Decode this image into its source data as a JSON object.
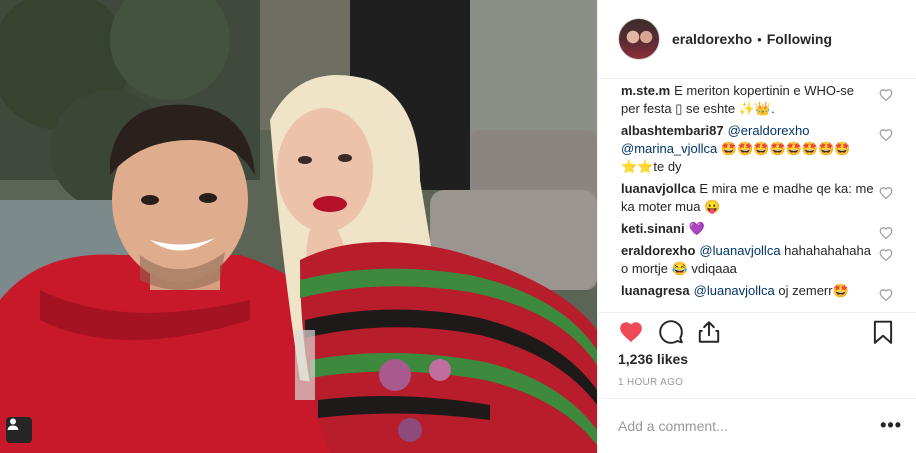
{
  "post": {
    "photo_alt": "",
    "header": {
      "username": "eraldorexho",
      "separator": "•",
      "follow_status": "Following"
    },
    "comments": [
      {
        "user": "m.ste.m",
        "segments": [
          {
            "type": "text",
            "value": "E meriton kopertinin e WHO-se per festa ▯ se eshte ✨👑."
          }
        ]
      },
      {
        "user": "albashtembari87",
        "segments": [
          {
            "type": "mention",
            "value": "@eraldorexho"
          },
          {
            "type": "text",
            "value": " "
          },
          {
            "type": "mention",
            "value": "@marina_vjollca"
          },
          {
            "type": "text",
            "value": " 🤩🤩🤩🤩🤩🤩🤩🤩⭐⭐te dy"
          }
        ]
      },
      {
        "user": "luanavjollca",
        "segments": [
          {
            "type": "text",
            "value": "E mira me e madhe qe ka: me ka moter mua 😛"
          }
        ]
      },
      {
        "user": "keti.sinani",
        "segments": [
          {
            "type": "text",
            "value": "💜"
          }
        ]
      },
      {
        "user": "eraldorexho",
        "segments": [
          {
            "type": "mention",
            "value": "@luanavjollca"
          },
          {
            "type": "text",
            "value": " hahahahahaha o mortje 😂 vdiqaaa"
          }
        ]
      },
      {
        "user": "luanagresa",
        "segments": [
          {
            "type": "mention",
            "value": "@luanavjollca"
          },
          {
            "type": "text",
            "value": " oj zemerr🤩"
          }
        ]
      }
    ],
    "actions": {
      "like_icon": "heart-filled-icon",
      "comment_icon": "comment-icon",
      "share_icon": "share-icon",
      "save_icon": "bookmark-icon",
      "like_color": "#ed4956"
    },
    "likes": "1,236 likes",
    "time": "1 HOUR AGO",
    "add_comment": {
      "placeholder": "Add a comment...",
      "more": "•••"
    }
  }
}
